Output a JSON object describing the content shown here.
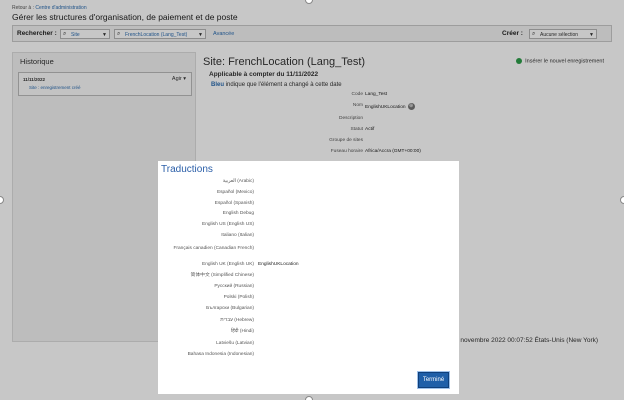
{
  "breadcrumb": {
    "prefix": "Retour à :",
    "link": "Centre d'administration"
  },
  "page_title": "Gérer les structures d'organisation, de paiement et de poste",
  "search": {
    "label": "Rechercher :",
    "type_select": "Site",
    "value_select": "FrenchLocation (Lang_Test)",
    "advanced_link": "Avancée",
    "create_label": "Créer :",
    "create_select": "Aucune sélection"
  },
  "history": {
    "title": "Historique",
    "entry_date": "11/11/2022",
    "entry_desc": "Site : enregistrement créé",
    "action_label": "Agir ▾"
  },
  "detail": {
    "title": "Site: FrenchLocation (Lang_Test)",
    "insert_label": "Insérer le nouvel enregistrement",
    "applicable": "Applicable à compter du  11/11/2022",
    "legend_blue": "Bleu",
    "legend_rest": " indique que l'élément a changé à cette date",
    "fields": [
      {
        "key": "Code",
        "value": "Lang_Test"
      },
      {
        "key": "Nom",
        "value": "EnglishUKLocation"
      },
      {
        "key": "Description",
        "value": ""
      },
      {
        "key": "Statut",
        "value": "Actif"
      },
      {
        "key": "Groupe de sites",
        "value": ""
      },
      {
        "key": "Fuseau horaire",
        "value": "Africa/Accra (GMT+00:00)"
      }
    ],
    "timestamp": "1 novembre 2022 00:07:52 États-Unis (New York)"
  },
  "modal": {
    "title": "Traductions",
    "done_label": "Terminé",
    "languages": [
      {
        "label": "العربية (Arabic)",
        "value": ""
      },
      {
        "label": "Español (Mexico)",
        "value": ""
      },
      {
        "label": "Español (Spanish)",
        "value": ""
      },
      {
        "label": "English Debug",
        "value": ""
      },
      {
        "label": "English US (English US)",
        "value": ""
      },
      {
        "label": "Italiano (Italian)",
        "value": ""
      },
      {
        "label": "Français canadien (Canadian French)",
        "value": ""
      },
      {
        "label": "English UK (English UK)",
        "value": "EnglishUKLocation"
      },
      {
        "label": "简体中文 (Simplified Chinese)",
        "value": ""
      },
      {
        "label": "Русский (Russian)",
        "value": ""
      },
      {
        "label": "Polski (Polish)",
        "value": ""
      },
      {
        "label": "Български (Bulgarian)",
        "value": ""
      },
      {
        "label": "עברית (Hebrew)",
        "value": ""
      },
      {
        "label": "हिंदी (Hindi)",
        "value": ""
      },
      {
        "label": "Latviešu (Latvian)",
        "value": ""
      },
      {
        "label": "Bahasa Indonesia (Indonesian)",
        "value": ""
      }
    ]
  }
}
